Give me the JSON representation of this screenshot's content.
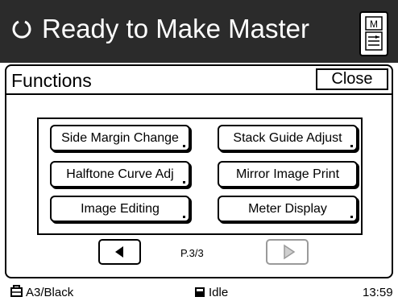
{
  "header": {
    "title": "Ready to Make Master",
    "status_icon": "power-cycle-icon",
    "master_button_icon": "master-document-icon",
    "master_button_letter": "M"
  },
  "panel": {
    "title": "Functions",
    "close_label": "Close",
    "buttons": [
      {
        "label": "Side Margin Change",
        "has_dot": true
      },
      {
        "label": "Stack Guide Adjust",
        "has_dot": true
      },
      {
        "label": "Halftone Curve Adj",
        "has_dot": true
      },
      {
        "label": "Mirror Image Print",
        "has_dot": false
      },
      {
        "label": "Image Editing",
        "has_dot": true
      },
      {
        "label": "Meter Display",
        "has_dot": true
      }
    ],
    "pagination": {
      "indicator": "P.3/3",
      "prev_icon": "triangle-left-icon",
      "next_icon": "triangle-right-icon",
      "next_disabled": true
    }
  },
  "status": {
    "paper": "A3/Black",
    "paper_icon": "drum-icon",
    "state": "Idle",
    "state_icon": "square-machine-icon",
    "time": "13:59"
  },
  "colors": {
    "titlebar_bg": "#2b2b2b",
    "title_text": "#ffffff",
    "disabled": "#9a9a9a"
  }
}
